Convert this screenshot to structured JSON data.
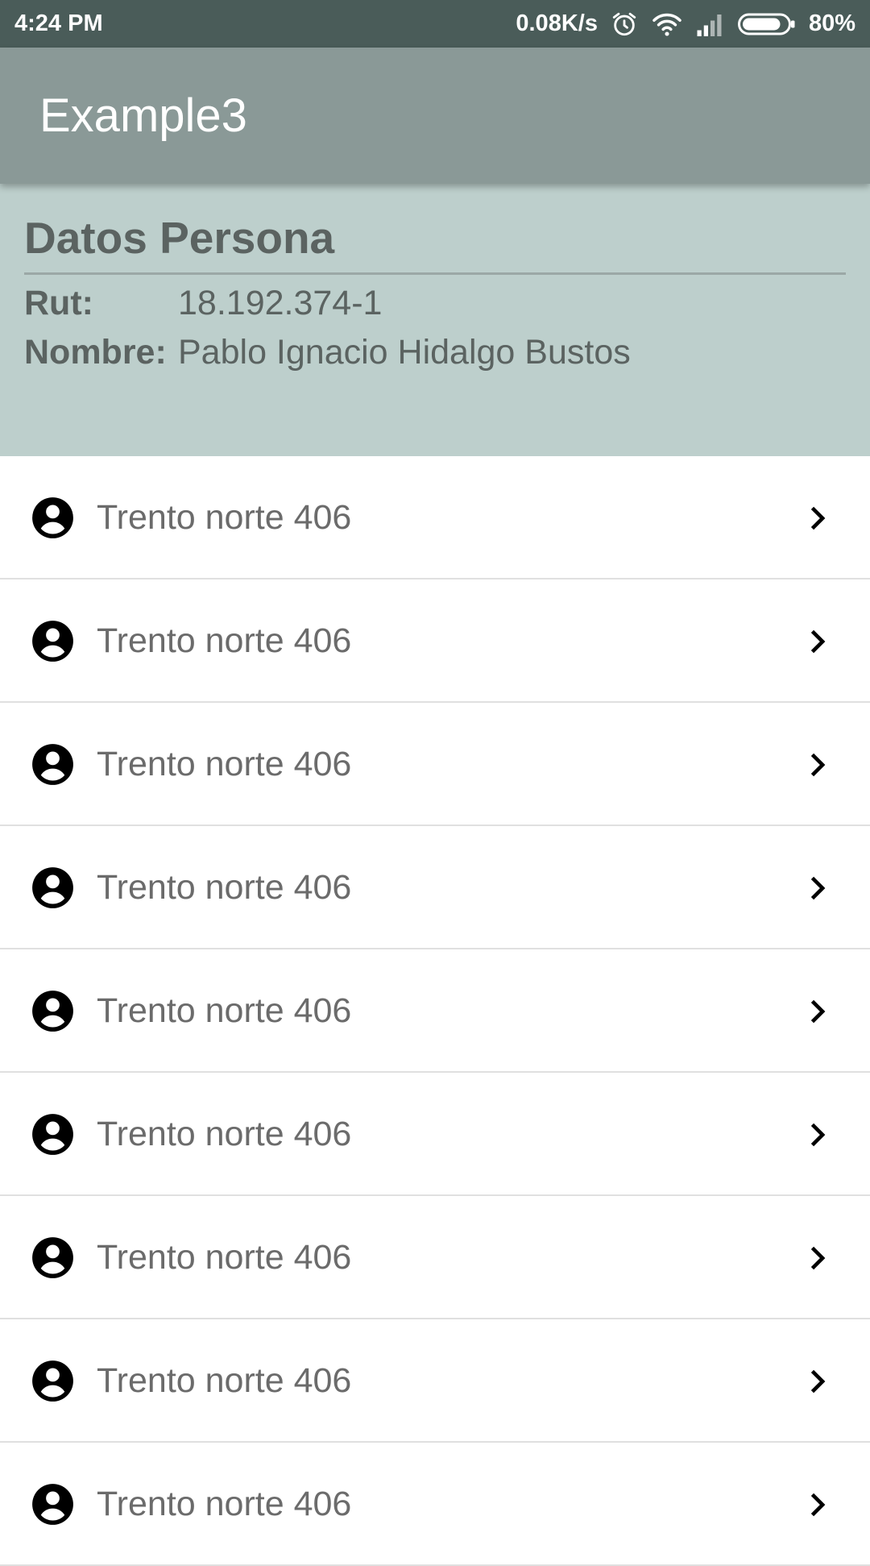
{
  "status_bar": {
    "time": "4:24 PM",
    "network_speed": "0.08K/s",
    "battery": "80%",
    "icons": [
      "alarm-icon",
      "wifi-icon",
      "signal-icon",
      "battery-icon"
    ]
  },
  "app_bar": {
    "title": "Example3"
  },
  "person": {
    "title": "Datos Persona",
    "rut_label": "Rut:",
    "rut_value": "18.192.374-1",
    "nombre_label": "Nombre:",
    "nombre_value": "Pablo Ignacio Hidalgo Bustos"
  },
  "list": {
    "item_icon": "account-circle-icon",
    "trailing_icon": "chevron-right-icon",
    "items": [
      {
        "label": "Trento norte 406"
      },
      {
        "label": "Trento norte 406"
      },
      {
        "label": "Trento norte 406"
      },
      {
        "label": "Trento norte 406"
      },
      {
        "label": "Trento norte 406"
      },
      {
        "label": "Trento norte 406"
      },
      {
        "label": "Trento norte 406"
      },
      {
        "label": "Trento norte 406"
      },
      {
        "label": "Trento norte 406"
      }
    ]
  },
  "colors": {
    "status_bar": "#4a5c59",
    "app_bar": "#8a9997",
    "panel": "#bdcfcc",
    "panel_text": "#5b6361",
    "list_text": "#6b6b6b",
    "divider": "#e0e0e0"
  }
}
